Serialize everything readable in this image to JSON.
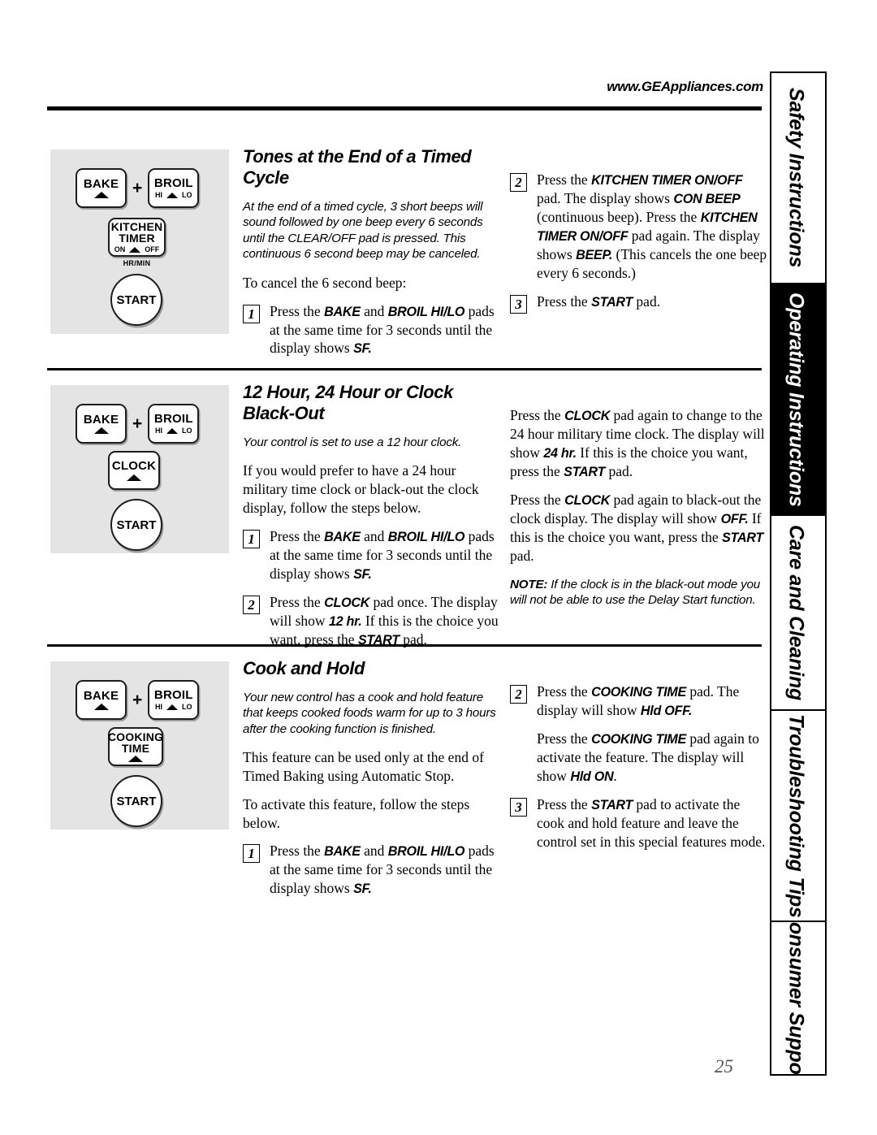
{
  "header": {
    "url": "www.GEAppliances.com"
  },
  "page_number": "25",
  "tabs": [
    {
      "label": "Safety Instructions",
      "active": false
    },
    {
      "label": "Operating Instructions",
      "active": true
    },
    {
      "label": "Care and Cleaning",
      "active": false
    },
    {
      "label": "Troubleshooting Tips",
      "active": false
    },
    {
      "label": "Consumer Support",
      "active": false
    }
  ],
  "pads": {
    "bake": "BAKE",
    "broil": "BROIL",
    "broil_hi": "HI",
    "broil_lo": "LO",
    "plus": "+",
    "kitchen_timer_line1": "KITCHEN",
    "kitchen_timer_line2": "TIMER",
    "kitchen_timer_on": "ON",
    "kitchen_timer_off": "OFF",
    "hrmin": "HR/MIN",
    "clock": "CLOCK",
    "cooking_time_line1": "COOKING",
    "cooking_time_line2": "TIME",
    "start": "START"
  },
  "sections": [
    {
      "title": "Tones at the End of a Timed Cycle",
      "intro": "At the end of a timed cycle, 3 short beeps will sound followed by one beep every 6 seconds until the CLEAR/OFF pad is pressed. This continuous 6 second beep may be canceled.",
      "lead": "To cancel the 6 second beep:",
      "step1_num": "1",
      "step2_num": "2",
      "step3_num": "3",
      "right_step2_num": "2",
      "right_step3_num": "3"
    },
    {
      "title": "12 Hour, 24 Hour or Clock Black-Out",
      "intro": "Your control is set to use a 12 hour clock.",
      "body1": "If you would prefer to have a 24 hour military time clock or black-out the clock display, follow the steps below.",
      "step1_num": "1",
      "step2_num": "2",
      "note_label": "NOTE:",
      "note_text": " If the clock is in the black-out mode you will not be able to use the Delay Start function."
    },
    {
      "title": "Cook and Hold",
      "intro": "Your new control has a cook and hold feature that keeps cooked foods warm for up to 3 hours after the cooking function is finished.",
      "body1": "This feature can be used only at the end of Timed Baking using Automatic Stop.",
      "body2": "To activate this feature, follow the steps below.",
      "step1_num": "1",
      "step2_num": "2",
      "step3_num": "3"
    }
  ],
  "s1": {
    "step1_a": "Press the ",
    "step1_bake": "BAKE",
    "step1_b": " and ",
    "step1_broil": "BROIL HI/LO",
    "step1_c": " pads at the same time for 3 seconds until the display shows ",
    "step1_sf": "SF.",
    "step2_a": "Press the ",
    "step2_kt1": "KITCHEN TIMER ON/OFF",
    "step2_b": " pad. The display shows ",
    "step2_conbeep": "CON BEEP",
    "step2_c": " (continuous beep). Press the ",
    "step2_kt2": "KITCHEN TIMER ON/OFF",
    "step2_d": " pad again. The display shows ",
    "step2_beep": "BEEP.",
    "step2_e": " (This cancels the one beep every 6 seconds.)",
    "step3_a": "Press the ",
    "step3_start": "START",
    "step3_b": " pad."
  },
  "s2": {
    "step1_a": "Press the ",
    "step1_bake": "BAKE",
    "step1_b": " and ",
    "step1_broil": "BROIL HI/LO",
    "step1_c": " pads at the same time for 3 seconds until the display shows ",
    "step1_sf": "SF.",
    "step2_a": "Press the ",
    "step2_clock": "CLOCK",
    "step2_b": " pad once. The display will show ",
    "step2_12hr": "12 hr.",
    "step2_c": "  If this is the choice you want, press the ",
    "step2_start": "START",
    "step2_d": " pad.",
    "r1_a": "Press the ",
    "r1_clock": "CLOCK",
    "r1_b": " pad again to change to the 24 hour military time clock. The display will show ",
    "r1_24hr": "24 hr.",
    "r1_c": "  If this is the choice you want, press the ",
    "r1_start": "START",
    "r1_d": " pad.",
    "r2_a": "Press the ",
    "r2_clock": "CLOCK",
    "r2_b": " pad again to black-out the clock display. The display will show ",
    "r2_off": "OFF.",
    "r2_c": "  If this is the choice you want, press the ",
    "r2_start": "START",
    "r2_d": " pad."
  },
  "s3": {
    "step1_a": "Press the ",
    "step1_bake": "BAKE",
    "step1_b": " and ",
    "step1_broil": "BROIL HI/LO",
    "step1_c": " pads at the same time for 3 seconds until the display shows ",
    "step1_sf": "SF.",
    "step2_a": "Press the ",
    "step2_ct": "COOKING TIME",
    "step2_b": " pad. The display will show ",
    "step2_hldoff": "Hld OFF.",
    "step2b_a": "Press the ",
    "step2b_ct": "COOKING TIME",
    "step2b_b": " pad again to activate the feature. The display will show ",
    "step2b_hldon": "Hld ON",
    "step2b_c": ".",
    "step3_a": "Press the ",
    "step3_start": "START",
    "step3_b": " pad to activate the cook and hold feature and leave the control set in this special features mode."
  }
}
